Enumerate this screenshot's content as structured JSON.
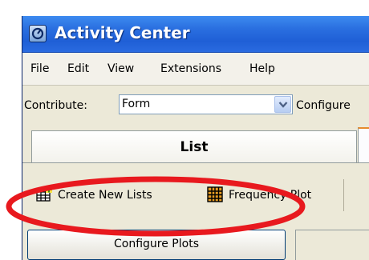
{
  "window": {
    "title": "Activity Center",
    "titlebar_color": "#2a6fe0"
  },
  "menubar": {
    "items": [
      "File",
      "Edit",
      "View",
      "Extensions",
      "Help"
    ]
  },
  "toolbar": {
    "contribute_label": "Contribute:",
    "contribute_value": "Form",
    "configure_label": "Configure"
  },
  "tabs": [
    {
      "label": "List",
      "selected": true
    }
  ],
  "plugin_bar": {
    "buttons": [
      {
        "label": "Create New Lists",
        "icon": "table-add-icon"
      },
      {
        "label": "Frequency Plot",
        "icon": "frequency-grid-icon"
      }
    ]
  },
  "panel": {
    "configure_plots_label": "Configure Plots"
  },
  "annotation": {
    "type": "red-ellipse",
    "color": "#e8191e",
    "highlights": "Create New Lists"
  }
}
